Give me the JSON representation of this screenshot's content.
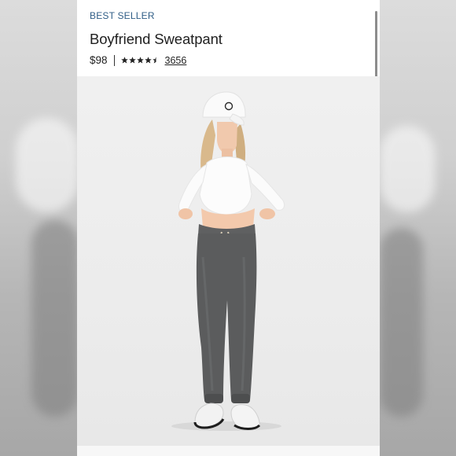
{
  "product": {
    "badge": "BEST SELLER",
    "title": "Boyfriend Sweatpant",
    "price": "$98",
    "rating": 4.5,
    "review_count": "3656"
  },
  "icons": {
    "stars": "star-rating-icon",
    "cap_logo": "circle-logo-icon"
  },
  "colors": {
    "badge": "#2f5d86",
    "text": "#1f1f1f",
    "pants": "#5b5c5d"
  }
}
